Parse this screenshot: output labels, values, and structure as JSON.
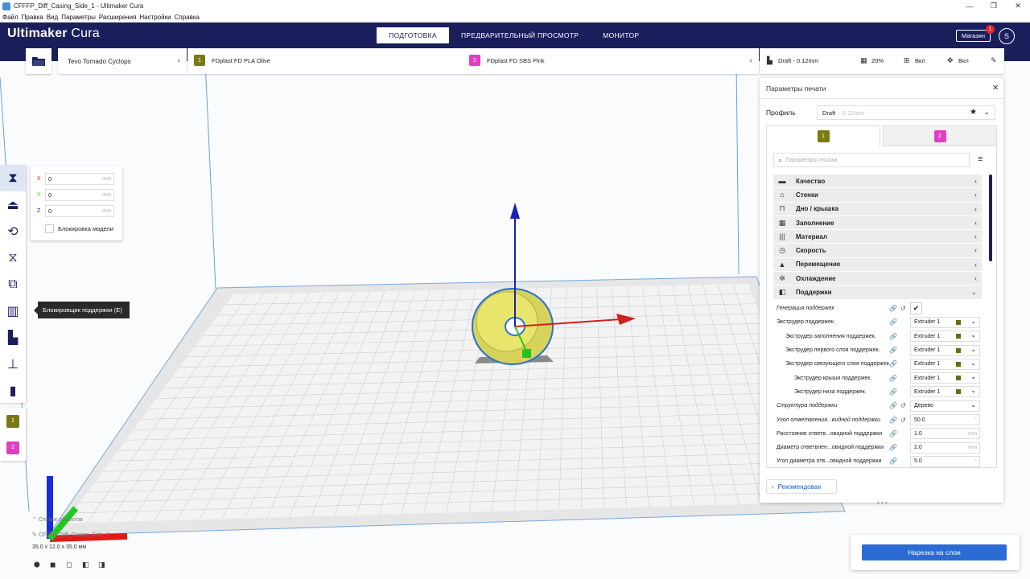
{
  "window": {
    "title": "CFFFP_Diff_Casing_Side_1 - Ultimaker Cura",
    "controls": {
      "minimize": "—",
      "maximize": "❐",
      "close": "✕"
    }
  },
  "menu": [
    "Файл",
    "Правка",
    "Вид",
    "Параметры",
    "Расширения",
    "Настройки",
    "Справка"
  ],
  "header": {
    "brand_bold": "Ultimaker",
    "brand_light": " Cura",
    "tabs": [
      "ПОДГОТОВКА",
      "ПРЕДВАРИТЕЛЬНЫЙ ПРОСМОТР",
      "МОНИТОР"
    ],
    "store_label": "Магазин",
    "store_badge": "1",
    "avatar": "S"
  },
  "machine": {
    "name": "Tevo Tornado Cyclops"
  },
  "materials": [
    {
      "badge": "1",
      "name": "FDplast FD PLA Olive",
      "color": "#7a7a12"
    },
    {
      "badge": "2",
      "name": "FDplast FD SBS Pink",
      "color": "#e03fc3"
    }
  ],
  "print_summary": {
    "profile": "Draft - 0.12mm",
    "infill": "20%",
    "support": "Вкл",
    "adhesion": "Вкл"
  },
  "move_panel": {
    "x_label": "X",
    "y_label": "Y",
    "z_label": "Z",
    "x": "0",
    "y": "0",
    "z": "0",
    "unit": "mm",
    "lock_label": "Блокировка модели"
  },
  "tooltip": "Блокировщик поддержки (E)",
  "settings_panel": {
    "title": "Параметры печати",
    "profile_label": "Профиль",
    "profile_value": "Draft",
    "profile_sub": "- 0.12mm",
    "tab1_badge": "1",
    "tab2_badge": "2",
    "search_placeholder": "Параметры поиска",
    "categories": [
      {
        "icon": "▬",
        "label": "Качество"
      },
      {
        "icon": "⌂",
        "label": "Стенки"
      },
      {
        "icon": "⊓",
        "label": "Дно / крышка"
      },
      {
        "icon": "▦",
        "label": "Заполнение"
      },
      {
        "icon": "|||",
        "label": "Материал"
      },
      {
        "icon": "◷",
        "label": "Скорость"
      },
      {
        "icon": "▲",
        "label": "Перемещение"
      },
      {
        "icon": "✲",
        "label": "Охлаждение"
      },
      {
        "icon": "◧",
        "label": "Поддержки"
      }
    ],
    "rows": [
      {
        "name": "Генерация поддержек",
        "italic": true,
        "indent": 0,
        "type": "check",
        "value": "✔",
        "reset": true
      },
      {
        "name": "Экструдер поддержек.",
        "italic": false,
        "indent": 0,
        "type": "extruder",
        "value": "Extruder 1",
        "reset": false
      },
      {
        "name": "Экструдер заполнения поддержек.",
        "italic": false,
        "indent": 1,
        "type": "extruder",
        "value": "Extruder 1",
        "reset": false
      },
      {
        "name": "Экструдер первого слоя поддержек.",
        "italic": false,
        "indent": 1,
        "type": "extruder",
        "value": "Extruder 1",
        "reset": false
      },
      {
        "name": "Экструдер связующего слоя поддержек.",
        "italic": false,
        "indent": 1,
        "type": "extruder",
        "value": "Extruder 1",
        "reset": false
      },
      {
        "name": "Экструдер крыши поддержек.",
        "italic": false,
        "indent": 2,
        "type": "extruder",
        "value": "Extruder 1",
        "reset": false
      },
      {
        "name": "Экструдер низа поддержек.",
        "italic": false,
        "indent": 2,
        "type": "extruder",
        "value": "Extruder 1",
        "reset": false
      },
      {
        "name": "Структура поддержки",
        "italic": true,
        "indent": 0,
        "type": "select",
        "value": "Дерево",
        "reset": true
      },
      {
        "name": "Угол ответвления...видной поддержки",
        "italic": true,
        "indent": 0,
        "type": "number",
        "value": "50.0",
        "unit": "°",
        "reset": true
      },
      {
        "name": "Расстояние ответв...овидной поддержки",
        "italic": false,
        "indent": 0,
        "type": "number",
        "value": "1.0",
        "unit": "mm",
        "reset": false
      },
      {
        "name": "Диаметр ответвлен...овидной поддержки",
        "italic": false,
        "indent": 0,
        "type": "number",
        "value": "2.0",
        "unit": "mm",
        "reset": false
      },
      {
        "name": "Угол диаметра отв...овидной поддержки",
        "italic": false,
        "indent": 0,
        "type": "number",
        "value": "5.0",
        "unit": "°",
        "reset": false
      }
    ],
    "recommended_label": "Рекомендован"
  },
  "slice_button": "Нарезка на слои",
  "objects": {
    "list_header": "Список объектов",
    "name": "CFFFP_Diff_Casing_Side_1",
    "dims": "35.0 x 12.0 x 35.0 мм"
  },
  "colors": {
    "header": "#1a1f5c",
    "accent": "#2b6cd4",
    "olive": "#7a7a12",
    "pink": "#e03fc3"
  }
}
